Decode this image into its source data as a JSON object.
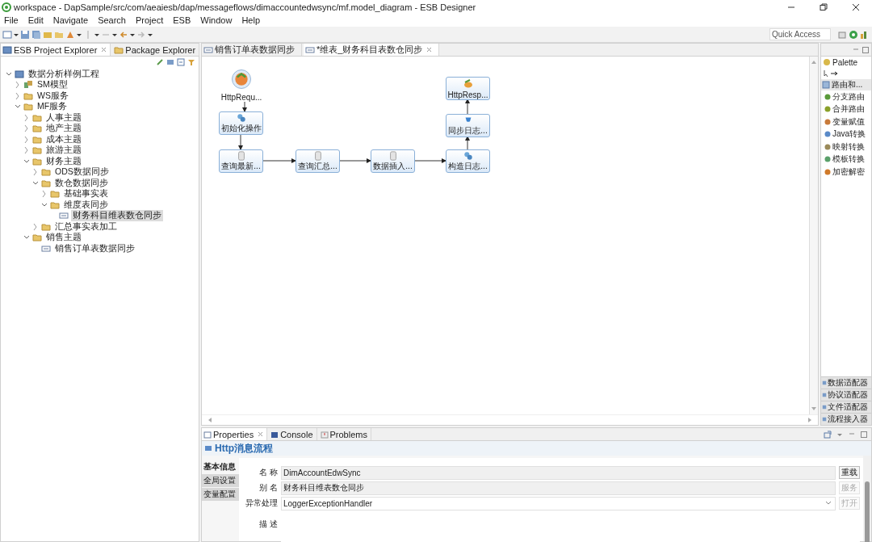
{
  "window": {
    "title": "workspace - DapSample/src/com/aeaiesb/dap/messageflows/dimaccountedwsync/mf.model_diagram - ESB Designer"
  },
  "menu": [
    "File",
    "Edit",
    "Navigate",
    "Search",
    "Project",
    "ESB",
    "Window",
    "Help"
  ],
  "quick_access": {
    "placeholder": "Quick Access"
  },
  "explorer": {
    "tabs": [
      {
        "label": "ESB Project Explorer",
        "selected": true
      },
      {
        "label": "Package Explorer",
        "selected": false
      }
    ],
    "tree": [
      {
        "label": "数据分析样例工程",
        "kind": "project",
        "expanded": true,
        "selected": false,
        "children": [
          {
            "label": "SM模型",
            "kind": "model",
            "expanded": false,
            "selected": false
          },
          {
            "label": "WS服务",
            "kind": "folder",
            "expanded": false,
            "selected": false
          },
          {
            "label": "MF服务",
            "kind": "folder",
            "expanded": true,
            "selected": false,
            "children": [
              {
                "label": "人事主题",
                "kind": "folder",
                "expanded": false,
                "selected": false
              },
              {
                "label": "地产主题",
                "kind": "folder",
                "expanded": false,
                "selected": false
              },
              {
                "label": "成本主题",
                "kind": "folder",
                "expanded": false,
                "selected": false
              },
              {
                "label": "旅游主题",
                "kind": "folder",
                "expanded": false,
                "selected": false
              },
              {
                "label": "财务主题",
                "kind": "folder",
                "expanded": true,
                "selected": false,
                "children": [
                  {
                    "label": "ODS数据同步",
                    "kind": "folder",
                    "expanded": false,
                    "selected": false
                  },
                  {
                    "label": "数仓数据同步",
                    "kind": "folder",
                    "expanded": true,
                    "selected": false,
                    "children": [
                      {
                        "label": "基础事实表",
                        "kind": "folder",
                        "expanded": false,
                        "selected": false
                      },
                      {
                        "label": "维度表同步",
                        "kind": "folder",
                        "expanded": true,
                        "selected": false,
                        "children": [
                          {
                            "label": "财务科目维表数仓同步",
                            "kind": "flow",
                            "selected": true
                          }
                        ]
                      }
                    ]
                  },
                  {
                    "label": "汇总事实表加工",
                    "kind": "folder",
                    "expanded": false,
                    "selected": false
                  }
                ]
              },
              {
                "label": "销售主题",
                "kind": "folder",
                "expanded": true,
                "selected": false,
                "children": [
                  {
                    "label": "销售订单表数据同步",
                    "kind": "flow",
                    "selected": false
                  }
                ]
              }
            ]
          }
        ]
      }
    ]
  },
  "editor": {
    "tabs": [
      {
        "label": "销售订单表数据同步",
        "selected": false
      },
      {
        "label": "*维表_财务科目表数仓同步",
        "selected": true
      }
    ],
    "nodes": [
      {
        "label": "HttpRequ...",
        "kind": "start"
      },
      {
        "label": "HttpResp...",
        "kind": "end"
      },
      {
        "label": "初始化操作",
        "kind": "task"
      },
      {
        "label": "同步日志...",
        "kind": "log"
      },
      {
        "label": "查询最新...",
        "kind": "db"
      },
      {
        "label": "查询汇总...",
        "kind": "db"
      },
      {
        "label": "数据插入...",
        "kind": "db"
      },
      {
        "label": "构造日志...",
        "kind": "task"
      }
    ]
  },
  "palette": {
    "title": "Palette",
    "group": "路由和...",
    "items": [
      "分支路由",
      "合并路由",
      "变量赋值",
      "Java转换",
      "映射转换",
      "模板转换",
      "加密解密"
    ],
    "drawers": [
      "数据适配器",
      "协议适配器",
      "文件适配器",
      "流程接入器"
    ]
  },
  "properties": {
    "tabs": [
      {
        "label": "Properties",
        "selected": true
      },
      {
        "label": "Console",
        "selected": false
      },
      {
        "label": "Problems",
        "selected": false
      }
    ],
    "title": "Http消息流程",
    "sections": [
      {
        "label": "基本信息",
        "selected": true
      },
      {
        "label": "全局设置",
        "selected": false
      },
      {
        "label": "变量配置",
        "selected": false
      }
    ],
    "fields": [
      {
        "label": "名 称",
        "kind": "text",
        "value": "DimAccountEdwSync",
        "button": "重载",
        "button_disabled": false
      },
      {
        "label": "别 名",
        "kind": "text",
        "value": "财务科目维表数仓同步",
        "button": "服务",
        "button_disabled": true
      },
      {
        "label": "异常处理",
        "kind": "select",
        "value": "LoggerExceptionHandler",
        "button": "打开",
        "button_disabled": true
      },
      {
        "label": "描 述",
        "kind": "area"
      }
    ]
  }
}
